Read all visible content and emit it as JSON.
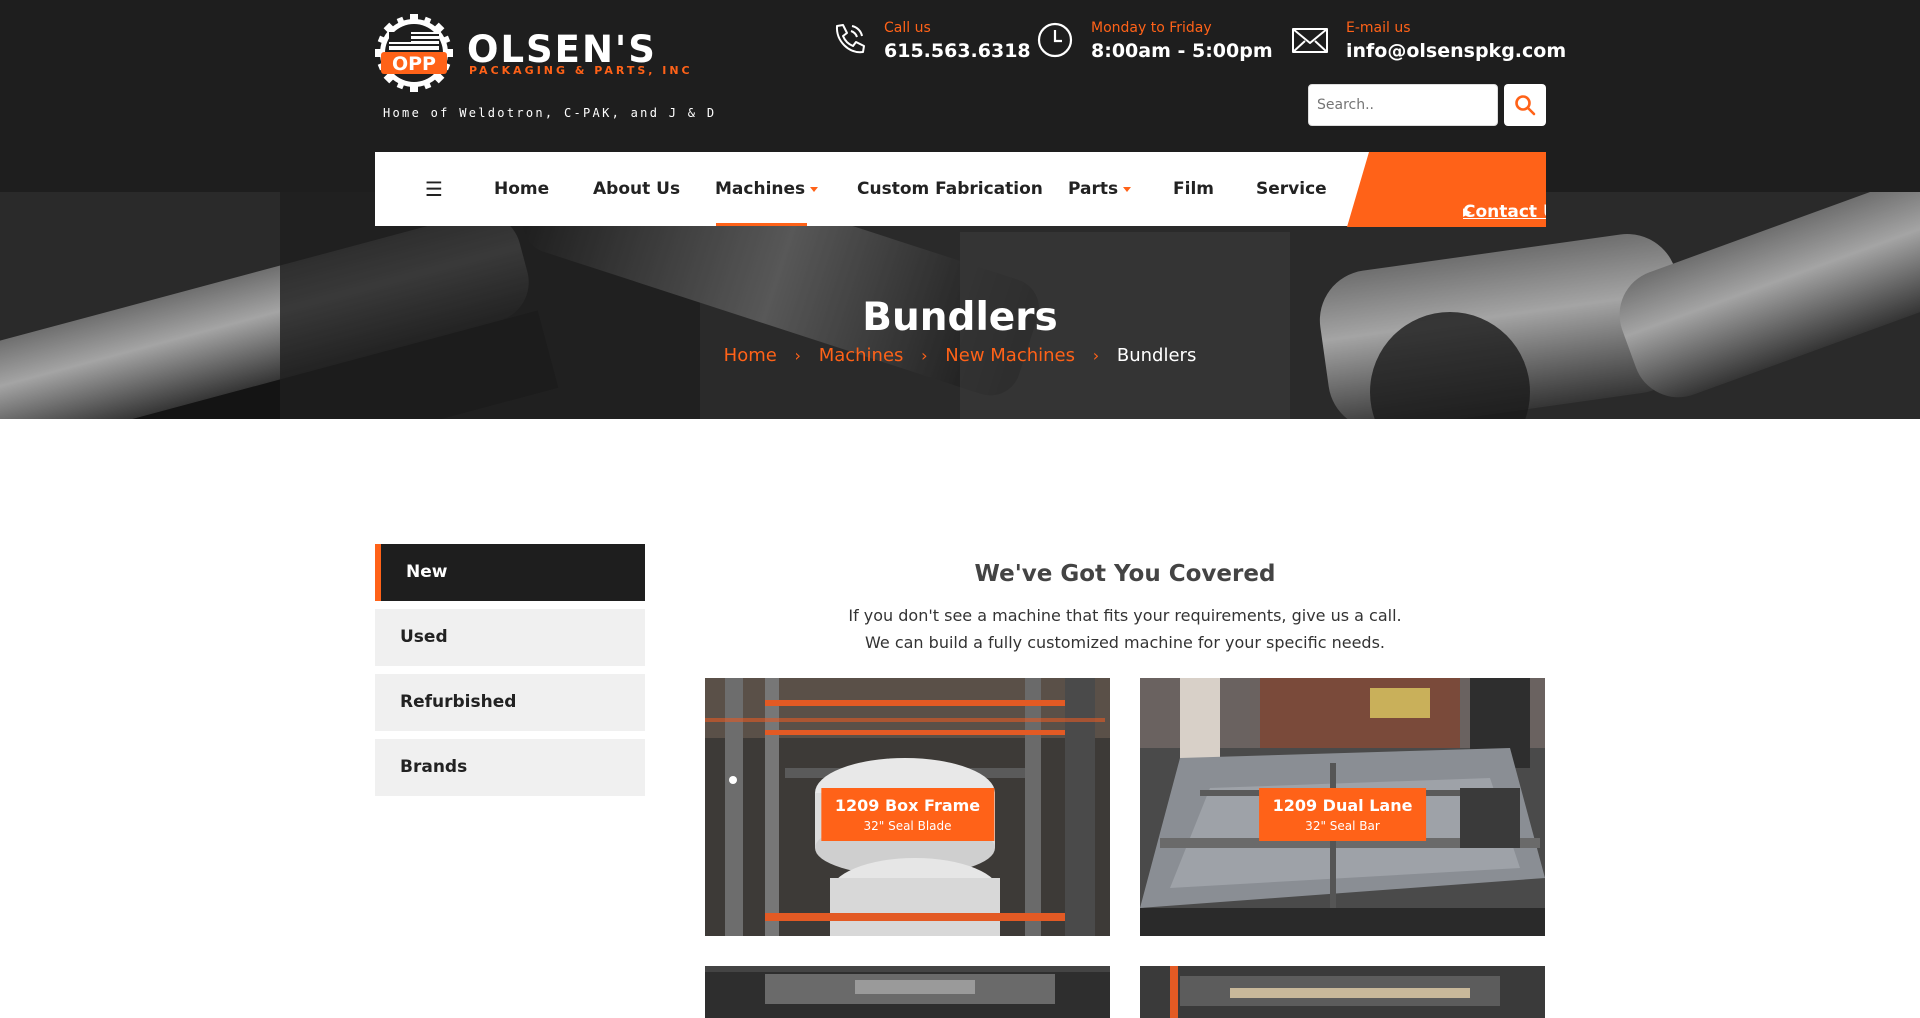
{
  "brand": {
    "logo_mark": "OPP",
    "name": "OLSEN'S",
    "subtitle": "PACKAGING & PARTS, INC",
    "tagline": "Home of Weldotron, C-PAK, and J & D"
  },
  "contact": {
    "phone_label": "Call us",
    "phone": "615.563.6318",
    "hours_label": "Monday to Friday",
    "hours": "8:00am - 5:00pm",
    "email_label": "E-mail us",
    "email": "info@olsenspkg.com"
  },
  "search": {
    "placeholder": "Search.."
  },
  "nav": {
    "menu_icon": "☰",
    "items": [
      {
        "label": "Home"
      },
      {
        "label": "About Us"
      },
      {
        "label": "Machines"
      },
      {
        "label": "Custom Fabrication"
      },
      {
        "label": "Parts"
      },
      {
        "label": "Film"
      },
      {
        "label": "Service"
      }
    ],
    "active": "Machines",
    "cta": "Contact Us",
    "cta_arrow": "▸"
  },
  "hero": {
    "title": "Bundlers",
    "breadcrumbs": [
      "Home",
      "Machines",
      "New Machines",
      "Bundlers"
    ]
  },
  "sidebar": {
    "items": [
      {
        "label": "New",
        "active": true
      },
      {
        "label": "Used",
        "active": false
      },
      {
        "label": "Refurbished",
        "active": false
      },
      {
        "label": "Brands",
        "active": false
      }
    ]
  },
  "main": {
    "title": "We've Got You Covered",
    "desc_line1": "If you don't see a machine that fits your requirements, give us a call.",
    "desc_line2": "We can build a fully customized machine for your specific needs.",
    "products": [
      {
        "name": "1209 Box Frame",
        "spec": "32\" Seal Blade"
      },
      {
        "name": "1209 Dual Lane",
        "spec": "32\" Seal Bar"
      }
    ]
  },
  "colors": {
    "accent": "#ff6218",
    "dark": "#1e1e1e",
    "light_gray": "#f0f0f0"
  },
  "icons": [
    "phone-icon",
    "clock-icon",
    "mail-icon",
    "search-icon",
    "menu-icon",
    "chevron-right-icon",
    "caret-down-icon"
  ]
}
